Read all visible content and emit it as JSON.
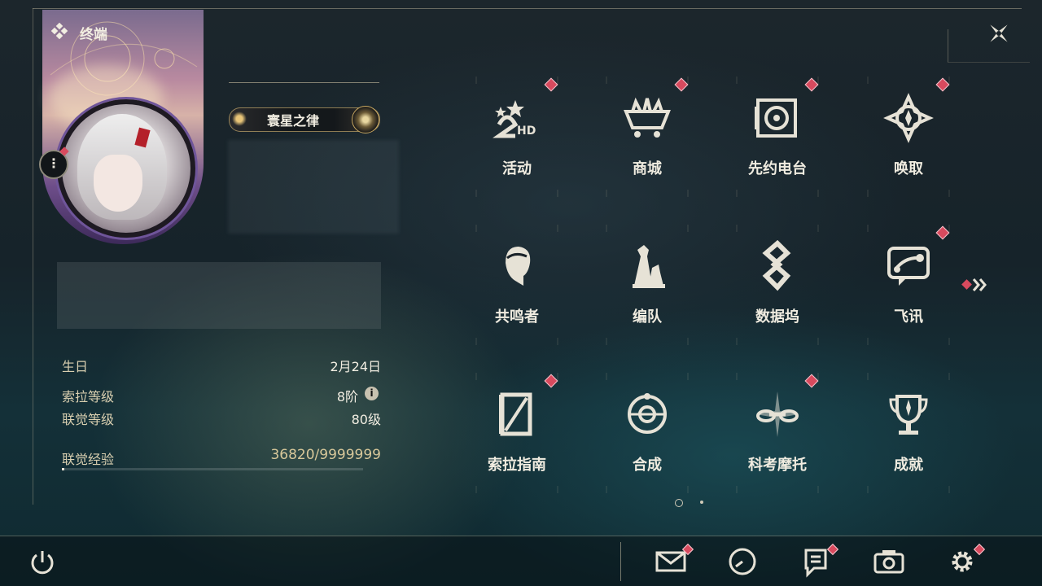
{
  "header": {
    "section_title": "终端"
  },
  "profile": {
    "title_badge": "寰星之律",
    "stats": [
      {
        "label": "生日",
        "value": "2月24日"
      },
      {
        "label": "索拉等级",
        "value": "8阶"
      },
      {
        "label": "联觉等级",
        "value": "80级"
      }
    ],
    "exp": {
      "label": "联觉经验",
      "value": "36820/9999999",
      "progress": 0.0037
    }
  },
  "menu": {
    "items": [
      {
        "label": "活动",
        "icon": "2hd-event-icon",
        "badge": true
      },
      {
        "label": "商城",
        "icon": "crown-cart-icon",
        "badge": true
      },
      {
        "label": "先约电台",
        "icon": "radio-disc-icon",
        "badge": true
      },
      {
        "label": "唤取",
        "icon": "compass-star-icon",
        "badge": true
      },
      {
        "label": "共鸣者",
        "icon": "character-head-icon",
        "badge": false
      },
      {
        "label": "编队",
        "icon": "chess-pieces-icon",
        "badge": false
      },
      {
        "label": "数据坞",
        "icon": "data-dock-icon",
        "badge": false
      },
      {
        "label": "飞讯",
        "icon": "chat-message-icon",
        "badge": true
      },
      {
        "label": "索拉指南",
        "icon": "guide-book-icon",
        "badge": true
      },
      {
        "label": "合成",
        "icon": "synthesis-orb-icon",
        "badge": false
      },
      {
        "label": "科考摩托",
        "icon": "motorbike-icon",
        "badge": true
      },
      {
        "label": "成就",
        "icon": "trophy-icon",
        "badge": false
      }
    ],
    "pages": 2,
    "current_page": 1
  },
  "bottom_bar": {
    "buttons": [
      {
        "name": "mail",
        "badge": true
      },
      {
        "name": "clock",
        "badge": false
      },
      {
        "name": "notes",
        "badge": true
      },
      {
        "name": "camera",
        "badge": false
      },
      {
        "name": "settings",
        "badge": true
      }
    ]
  },
  "colors": {
    "badge": "#d84a5e",
    "accent_gold": "#d8c89a",
    "text": "#f0ece0"
  }
}
